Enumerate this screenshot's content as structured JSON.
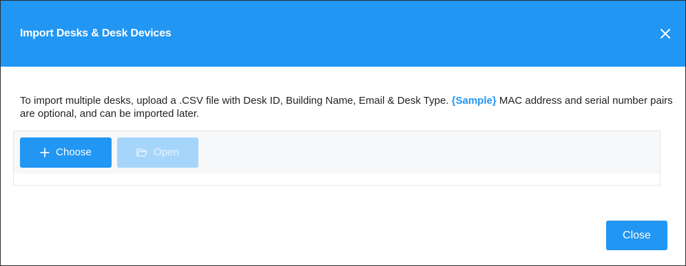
{
  "dialog": {
    "title": "Import Desks & Desk Devices",
    "close_icon": "close-icon"
  },
  "body": {
    "description_before": "To import multiple desks, upload a .CSV file with Desk ID, Building Name, Email & Desk Type. ",
    "sample_link": "{Sample}",
    "description_after": " MAC address and serial number pairs are optional, and can be imported later."
  },
  "upload": {
    "choose_label": "Choose",
    "choose_icon": "plus-icon",
    "open_label": "Open",
    "open_icon": "folder-open-icon"
  },
  "footer": {
    "close_label": "Close"
  },
  "colors": {
    "accent": "#2196f3",
    "disabled": "#a6d5fb"
  }
}
